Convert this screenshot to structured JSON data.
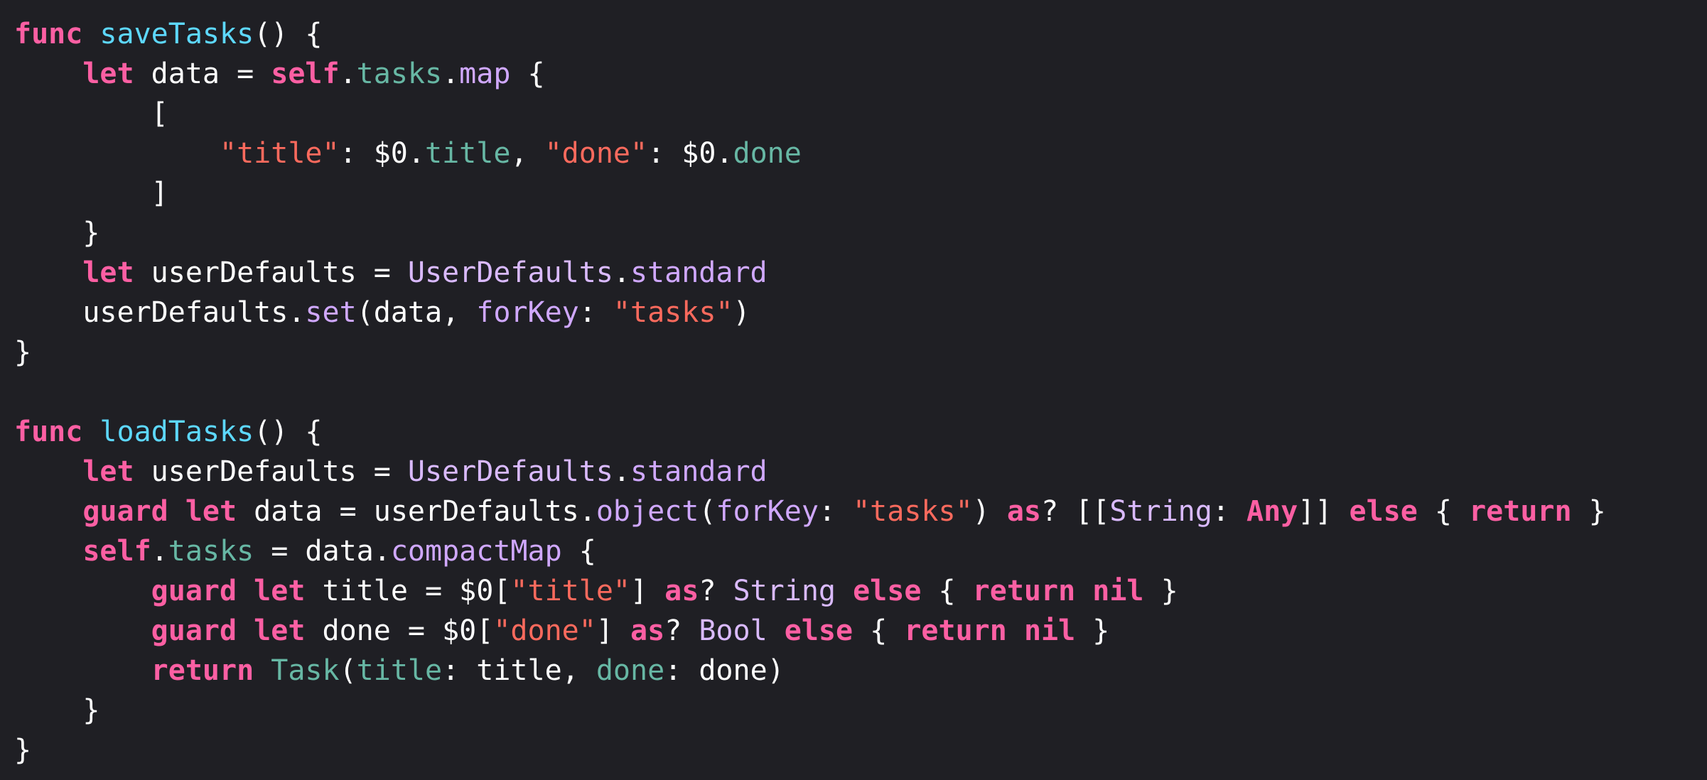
{
  "colors": {
    "background": "#1f1f24",
    "keyword": "#fc5fa3",
    "function_decl": "#5dd8ff",
    "project_property": "#67b7a4",
    "string": "#fc6a5d",
    "library_member": "#d0a8ff",
    "library_type": "#dabaff",
    "plain": "#ffffff"
  },
  "code": {
    "lines": [
      [
        {
          "t": "func",
          "k": "kw"
        },
        {
          "t": " ",
          "k": "plain"
        },
        {
          "t": "saveTasks",
          "k": "fn"
        },
        {
          "t": "() {",
          "k": "plain"
        }
      ],
      [
        {
          "t": "    ",
          "k": "plain"
        },
        {
          "t": "let",
          "k": "kw"
        },
        {
          "t": " data = ",
          "k": "plain"
        },
        {
          "t": "self",
          "k": "kw"
        },
        {
          "t": ".",
          "k": "plain"
        },
        {
          "t": "tasks",
          "k": "prop"
        },
        {
          "t": ".",
          "k": "plain"
        },
        {
          "t": "map",
          "k": "lib"
        },
        {
          "t": " {",
          "k": "plain"
        }
      ],
      [
        {
          "t": "        [",
          "k": "plain"
        }
      ],
      [
        {
          "t": "            ",
          "k": "plain"
        },
        {
          "t": "\"title\"",
          "k": "str"
        },
        {
          "t": ": $0.",
          "k": "plain"
        },
        {
          "t": "title",
          "k": "prop"
        },
        {
          "t": ", ",
          "k": "plain"
        },
        {
          "t": "\"done\"",
          "k": "str"
        },
        {
          "t": ": $0.",
          "k": "plain"
        },
        {
          "t": "done",
          "k": "prop"
        }
      ],
      [
        {
          "t": "        ]",
          "k": "plain"
        }
      ],
      [
        {
          "t": "    }",
          "k": "plain"
        }
      ],
      [
        {
          "t": "    ",
          "k": "plain"
        },
        {
          "t": "let",
          "k": "kw"
        },
        {
          "t": " userDefaults = ",
          "k": "plain"
        },
        {
          "t": "UserDefaults",
          "k": "type"
        },
        {
          "t": ".",
          "k": "plain"
        },
        {
          "t": "standard",
          "k": "lib"
        }
      ],
      [
        {
          "t": "    userDefaults.",
          "k": "plain"
        },
        {
          "t": "set",
          "k": "lib"
        },
        {
          "t": "(data, ",
          "k": "plain"
        },
        {
          "t": "forKey",
          "k": "lib"
        },
        {
          "t": ": ",
          "k": "plain"
        },
        {
          "t": "\"tasks\"",
          "k": "str"
        },
        {
          "t": ")",
          "k": "plain"
        }
      ],
      [
        {
          "t": "}",
          "k": "plain"
        }
      ],
      [],
      [
        {
          "t": "func",
          "k": "kw"
        },
        {
          "t": " ",
          "k": "plain"
        },
        {
          "t": "loadTasks",
          "k": "fn"
        },
        {
          "t": "() {",
          "k": "plain"
        }
      ],
      [
        {
          "t": "    ",
          "k": "plain"
        },
        {
          "t": "let",
          "k": "kw"
        },
        {
          "t": " userDefaults = ",
          "k": "plain"
        },
        {
          "t": "UserDefaults",
          "k": "type"
        },
        {
          "t": ".",
          "k": "plain"
        },
        {
          "t": "standard",
          "k": "lib"
        }
      ],
      [
        {
          "t": "    ",
          "k": "plain"
        },
        {
          "t": "guard",
          "k": "kw"
        },
        {
          "t": " ",
          "k": "plain"
        },
        {
          "t": "let",
          "k": "kw"
        },
        {
          "t": " data = userDefaults.",
          "k": "plain"
        },
        {
          "t": "object",
          "k": "lib"
        },
        {
          "t": "(",
          "k": "plain"
        },
        {
          "t": "forKey",
          "k": "lib"
        },
        {
          "t": ": ",
          "k": "plain"
        },
        {
          "t": "\"tasks\"",
          "k": "str"
        },
        {
          "t": ") ",
          "k": "plain"
        },
        {
          "t": "as",
          "k": "kw"
        },
        {
          "t": "? [[",
          "k": "plain"
        },
        {
          "t": "String",
          "k": "type"
        },
        {
          "t": ": ",
          "k": "plain"
        },
        {
          "t": "Any",
          "k": "kw"
        },
        {
          "t": "]] ",
          "k": "plain"
        },
        {
          "t": "else",
          "k": "kw"
        },
        {
          "t": " { ",
          "k": "plain"
        },
        {
          "t": "return",
          "k": "kw"
        },
        {
          "t": " }",
          "k": "plain"
        }
      ],
      [
        {
          "t": "    ",
          "k": "plain"
        },
        {
          "t": "self",
          "k": "kw"
        },
        {
          "t": ".",
          "k": "plain"
        },
        {
          "t": "tasks",
          "k": "prop"
        },
        {
          "t": " = data.",
          "k": "plain"
        },
        {
          "t": "compactMap",
          "k": "lib"
        },
        {
          "t": " {",
          "k": "plain"
        }
      ],
      [
        {
          "t": "        ",
          "k": "plain"
        },
        {
          "t": "guard",
          "k": "kw"
        },
        {
          "t": " ",
          "k": "plain"
        },
        {
          "t": "let",
          "k": "kw"
        },
        {
          "t": " title = $0[",
          "k": "plain"
        },
        {
          "t": "\"title\"",
          "k": "str"
        },
        {
          "t": "] ",
          "k": "plain"
        },
        {
          "t": "as",
          "k": "kw"
        },
        {
          "t": "? ",
          "k": "plain"
        },
        {
          "t": "String",
          "k": "type"
        },
        {
          "t": " ",
          "k": "plain"
        },
        {
          "t": "else",
          "k": "kw"
        },
        {
          "t": " { ",
          "k": "plain"
        },
        {
          "t": "return",
          "k": "kw"
        },
        {
          "t": " ",
          "k": "plain"
        },
        {
          "t": "nil",
          "k": "kw"
        },
        {
          "t": " }",
          "k": "plain"
        }
      ],
      [
        {
          "t": "        ",
          "k": "plain"
        },
        {
          "t": "guard",
          "k": "kw"
        },
        {
          "t": " ",
          "k": "plain"
        },
        {
          "t": "let",
          "k": "kw"
        },
        {
          "t": " done = $0[",
          "k": "plain"
        },
        {
          "t": "\"done\"",
          "k": "str"
        },
        {
          "t": "] ",
          "k": "plain"
        },
        {
          "t": "as",
          "k": "kw"
        },
        {
          "t": "? ",
          "k": "plain"
        },
        {
          "t": "Bool",
          "k": "type"
        },
        {
          "t": " ",
          "k": "plain"
        },
        {
          "t": "else",
          "k": "kw"
        },
        {
          "t": " { ",
          "k": "plain"
        },
        {
          "t": "return",
          "k": "kw"
        },
        {
          "t": " ",
          "k": "plain"
        },
        {
          "t": "nil",
          "k": "kw"
        },
        {
          "t": " }",
          "k": "plain"
        }
      ],
      [
        {
          "t": "        ",
          "k": "plain"
        },
        {
          "t": "return",
          "k": "kw"
        },
        {
          "t": " ",
          "k": "plain"
        },
        {
          "t": "Task",
          "k": "prop"
        },
        {
          "t": "(",
          "k": "plain"
        },
        {
          "t": "title",
          "k": "prop"
        },
        {
          "t": ": title, ",
          "k": "plain"
        },
        {
          "t": "done",
          "k": "prop"
        },
        {
          "t": ": done)",
          "k": "plain"
        }
      ],
      [
        {
          "t": "    }",
          "k": "plain"
        }
      ],
      [
        {
          "t": "}",
          "k": "plain"
        }
      ]
    ]
  }
}
